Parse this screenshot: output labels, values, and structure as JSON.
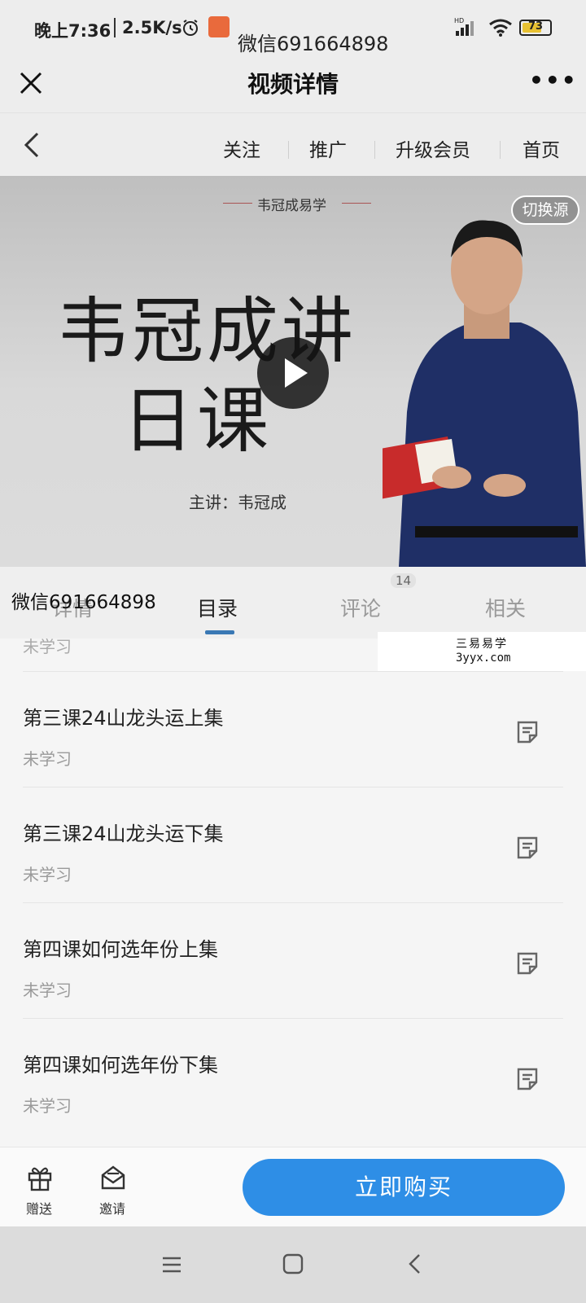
{
  "status_bar": {
    "time": "晚上7:36",
    "speed": "2.5K/s",
    "wechat_id": "微信691664898",
    "network": "HD",
    "battery": "73",
    "battery_level": 0.73
  },
  "title_bar": {
    "title": "视频详情",
    "more": "•••"
  },
  "page_nav": {
    "links": [
      "关注",
      "推广",
      "升级会员",
      "首页"
    ]
  },
  "video": {
    "banner": "韦冠成易学",
    "title_line1": "韦冠成讲",
    "title_line2": "日课",
    "presenter": "主讲：韦冠成",
    "switch_source": "切换源"
  },
  "tabs": {
    "items": [
      "详情",
      "目录",
      "评论",
      "相关"
    ],
    "active": "目录",
    "comment_count": "14",
    "watermark": "微信691664898"
  },
  "watermark_box": {
    "line1": "三易易学",
    "line2": "3yyx.com"
  },
  "lessons": {
    "partial_status": "未学习",
    "items": [
      {
        "title": "第三课24山龙头运上集",
        "status": "未学习"
      },
      {
        "title": "第三课24山龙头运下集",
        "status": "未学习"
      },
      {
        "title": "第四课如何选年份上集",
        "status": "未学习"
      },
      {
        "title": "第四课如何选年份下集",
        "status": "未学习"
      }
    ]
  },
  "bottom_bar": {
    "gift_label": "赠送",
    "invite_label": "邀请",
    "buy_label": "立即购买"
  },
  "colors": {
    "accent": "#2e8ee6",
    "tab_indicator": "#3a78b4",
    "muted_text": "#9a9a9a"
  }
}
